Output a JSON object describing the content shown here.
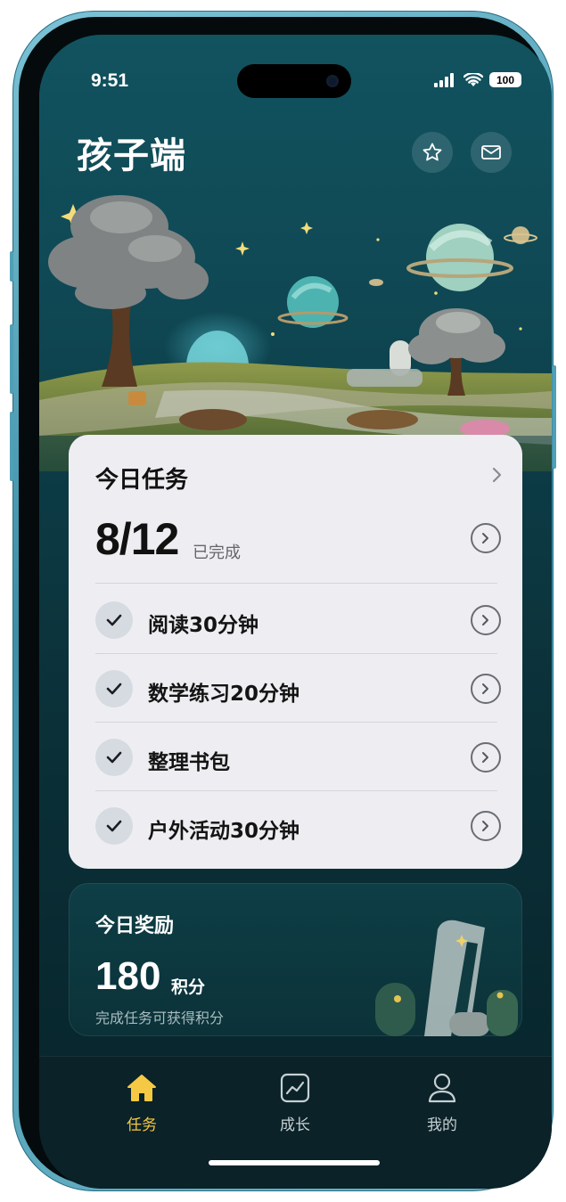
{
  "status": {
    "time": "9:51",
    "battery": "100"
  },
  "header": {
    "title": "孩子端",
    "star_icon": "star-icon",
    "mail_icon": "mail-icon"
  },
  "today_tasks": {
    "title": "今日任务",
    "completed": "8/12",
    "completed_label": "已完成",
    "items": [
      {
        "label": "阅读30分钟",
        "done": true
      },
      {
        "label": "数学练习20分钟",
        "done": true
      },
      {
        "label": "整理书包",
        "done": true
      },
      {
        "label": "户外活动30分钟",
        "done": true
      }
    ]
  },
  "reward": {
    "title": "今日奖励",
    "points": "180",
    "unit": "积分",
    "description": "完成任务可获得积分"
  },
  "tabs": [
    {
      "label": "任务",
      "icon": "home-icon",
      "active": true
    },
    {
      "label": "成长",
      "icon": "chart-icon",
      "active": false
    },
    {
      "label": "我的",
      "icon": "profile-icon",
      "active": false
    }
  ],
  "colors": {
    "accent": "#f6c944",
    "card_bg": "#eeeef2",
    "screen_bg": "#0d3f4a"
  }
}
